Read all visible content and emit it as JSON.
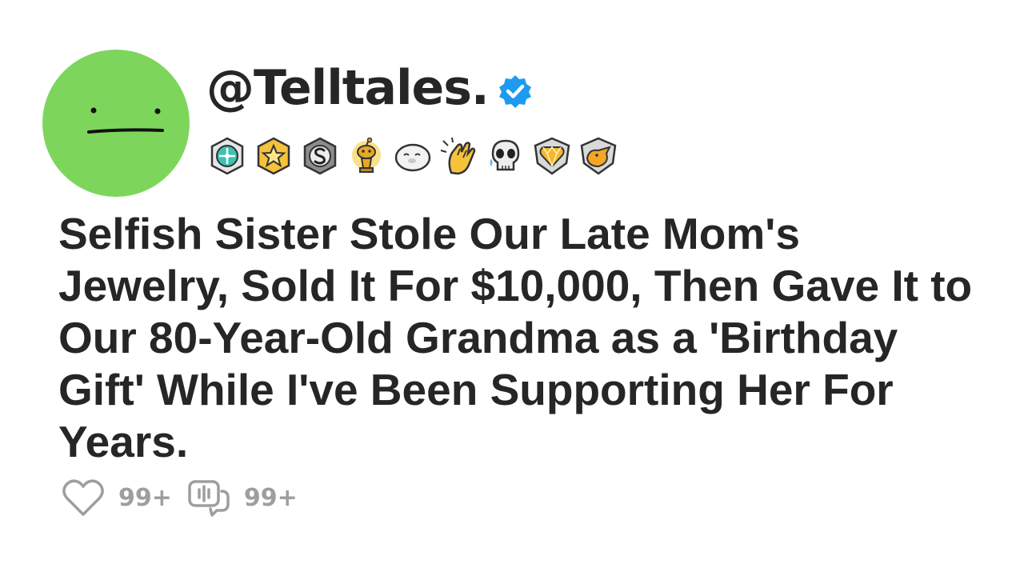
{
  "profile": {
    "username": "@Telltales.",
    "verified": true,
    "avatar_color": "#7dd65b"
  },
  "badges": [
    {
      "icon": "compass-medal-icon"
    },
    {
      "icon": "star-medal-icon"
    },
    {
      "icon": "s-coin-medal-icon"
    },
    {
      "icon": "gold-trophy-snoo-icon"
    },
    {
      "icon": "sleepy-seal-icon"
    },
    {
      "icon": "clapping-hands-icon"
    },
    {
      "icon": "crying-skull-icon"
    },
    {
      "icon": "gold-diamond-heart-icon"
    },
    {
      "icon": "gold-duck-shield-icon"
    }
  ],
  "post": {
    "title": "Selfish Sister Stole Our Late Mom's Jewelry, Sold It For $10,000, Then Gave It to Our 80-Year-Old Grandma as a 'Birthday Gift' While I've Been Supporting Her For Years."
  },
  "stats": {
    "likes": "99+",
    "comments": "99+",
    "like_icon": "heart-icon",
    "comment_icon": "comment-icon"
  },
  "colors": {
    "text": "#262626",
    "muted": "#9e9e9e",
    "verified_blue": "#1d9bf0"
  }
}
